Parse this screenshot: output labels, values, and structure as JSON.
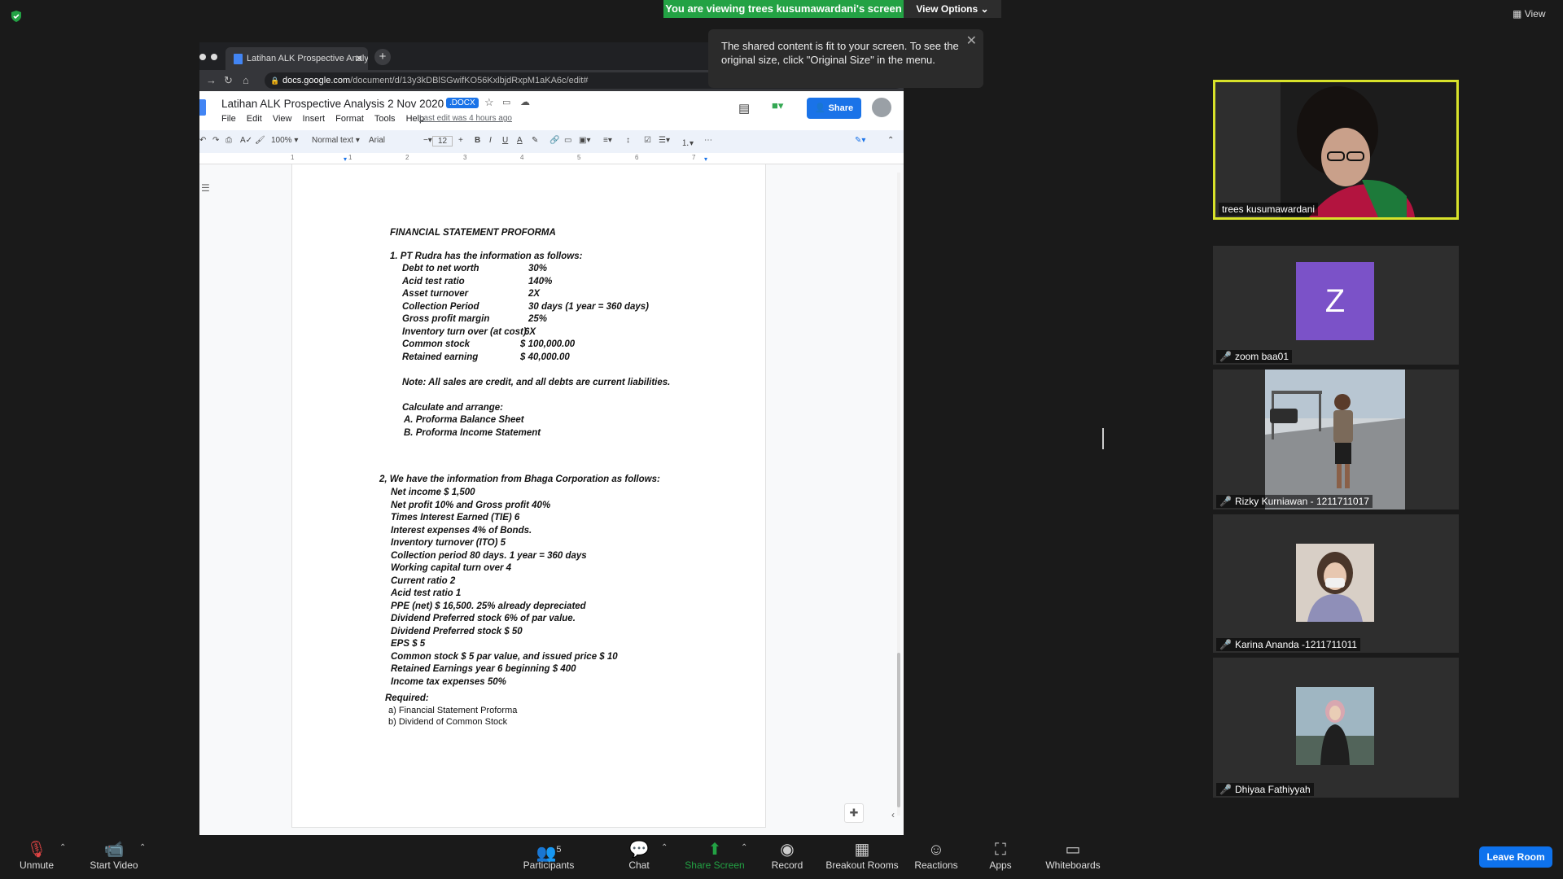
{
  "banner": {
    "viewing": "You are viewing trees kusumawardani's screen",
    "view_options": "View Options"
  },
  "top_right": {
    "view": "View"
  },
  "tooltip": {
    "text": "The shared content is fit to your screen. To see the original size, click \"Original Size\" in the menu."
  },
  "browser": {
    "tab_title": "Latihan ALK Prospective Analy",
    "url_host": "docs.google.com",
    "url_path": "/document/d/13y3kDBlSGwifKO56KxlbjdRxpM1aKA6c/edit#"
  },
  "doc": {
    "title": "Latihan ALK Prospective Analysis 2 Nov 2020",
    "badge": ".DOCX",
    "menu": [
      "File",
      "Edit",
      "View",
      "Insert",
      "Format",
      "Tools",
      "Help"
    ],
    "last_edit": "Last edit was 4 hours ago",
    "share": "Share",
    "toolbar": {
      "zoom": "100%",
      "style": "Normal text",
      "font": "Arial",
      "size": "12"
    },
    "ruler": [
      "1",
      "1",
      "2",
      "3",
      "4",
      "5",
      "6",
      "7"
    ],
    "heading": "FINANCIAL STATEMENT PROFORMA",
    "q1_intro": "1.  PT Rudra has the information as follows:",
    "q1_items": [
      {
        "label": "Debt to net worth",
        "value": "30%"
      },
      {
        "label": "Acid test ratio",
        "value": "140%"
      },
      {
        "label": "Asset turnover",
        "value": "2X"
      },
      {
        "label": "Collection Period",
        "value": "30 days (1 year = 360 days)"
      },
      {
        "label": "Gross profit margin",
        "value": "25%"
      },
      {
        "label": "Inventory turn over (at cost)",
        "value": "6X"
      },
      {
        "label": "Common stock",
        "value": "$ 100,000.00"
      },
      {
        "label": "Retained earning",
        "value": "$ 40,000.00"
      }
    ],
    "q1_note": "Note: All sales are credit, and all debts are current liabilities.",
    "q1_calc": "Calculate and arrange:",
    "q1_a": "A. Proforma Balance Sheet",
    "q1_b": "B. Proforma Income Statement",
    "q2_intro": "2, We have the information from Bhaga Corporation as follows:",
    "q2_items": [
      "Net income $ 1,500",
      "Net profit  10% and Gross profit 40%",
      "Times Interest Earned (TIE) 6",
      "Interest expenses 4% of Bonds.",
      "Inventory turnover  (ITO) 5",
      "Collection period 80 days. 1 year = 360 days",
      "Working capital turn over 4",
      "Current ratio 2",
      "Acid test ratio  1",
      "PPE (net) $ 16,500. 25%  already depreciated",
      "Dividend Preferred stock 6%  of  par value.",
      "Dividend Preferred stock $ 50",
      "EPS $ 5",
      "Common stock $ 5 par value, and issued price $ 10",
      "Retained Earnings year 6 beginning $ 400",
      "Income tax expenses 50%"
    ],
    "required": "Required:",
    "req_a": "a)  Financial Statement Proforma",
    "req_b": "b)  Dividend of Common Stock"
  },
  "participants_gallery": [
    {
      "name": "trees kusumawardani",
      "muted": false
    },
    {
      "name": "zoom baa01",
      "initial": "Z",
      "muted": true
    },
    {
      "name": "Rizky Kurniawan - 1211711017",
      "muted": true
    },
    {
      "name": "Karina Ananda -1211711011",
      "muted": true
    },
    {
      "name": "Dhiyaa Fathiyyah",
      "muted": true
    }
  ],
  "bottombar": {
    "unmute": "Unmute",
    "start_video": "Start Video",
    "participants": "Participants",
    "participants_count": "5",
    "chat": "Chat",
    "share_screen": "Share Screen",
    "record": "Record",
    "breakout": "Breakout Rooms",
    "reactions": "Reactions",
    "apps": "Apps",
    "whiteboards": "Whiteboards",
    "leave": "Leave Room"
  },
  "colors": {
    "share_green": "#23a244",
    "leave_blue": "#0e72ed",
    "active_speaker": "#d8e22a",
    "avatar_purple": "#7b52c8"
  }
}
